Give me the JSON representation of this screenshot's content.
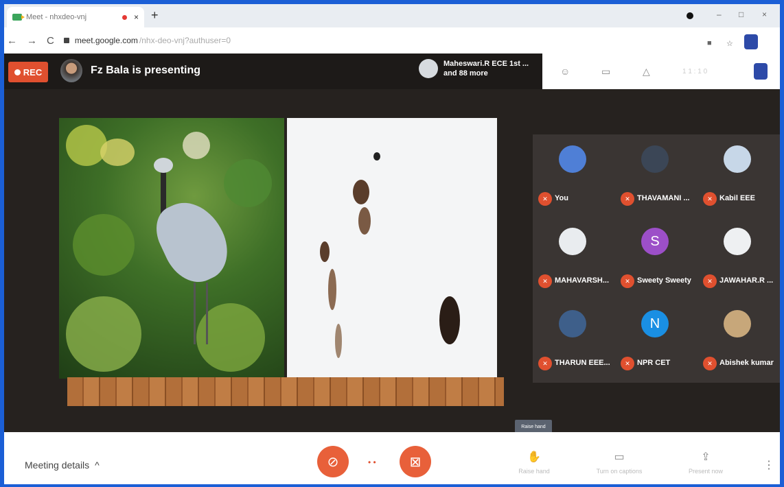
{
  "browser": {
    "tab_title": "Meet - nhxdeo-vnj",
    "tab_close": "×",
    "new_tab": "+",
    "win_controls": [
      "–",
      "□",
      "×"
    ],
    "nav": [
      "←",
      "→",
      "C"
    ],
    "url_host": "meet.google.com",
    "url_path": "/nhx-deo-vnj?authuser=0"
  },
  "meet": {
    "rec_label": "REC",
    "presenter_text": "Fz Bala is presenting",
    "people_line1": "Maheswari.R ECE 1st ...",
    "people_line2": "and 88 more",
    "top_icons": [
      "people-icon",
      "chat-icon",
      "activities-icon"
    ],
    "top_time": "1 1 : 1 0",
    "participants": [
      {
        "name": "You",
        "initial": "",
        "color": "#4f7fd6"
      },
      {
        "name": "THAVAMANI ...",
        "initial": "",
        "color": "#3b4656"
      },
      {
        "name": "Kabil EEE",
        "initial": "",
        "color": "#c7d7e8"
      },
      {
        "name": "MAHAVARSH...",
        "initial": "",
        "color": "#e9ecef"
      },
      {
        "name": "Sweety Sweety",
        "initial": "S",
        "color": "#9c4fc8"
      },
      {
        "name": "JAWAHAR.R ...",
        "initial": "",
        "color": "#eef0f2"
      },
      {
        "name": "THARUN EEE...",
        "initial": "",
        "color": "#3e5f8a"
      },
      {
        "name": "NPR CET",
        "initial": "N",
        "color": "#1a8fe3"
      },
      {
        "name": "Abishek kumar",
        "initial": "",
        "color": "#c7a77a"
      }
    ],
    "tooltip": "Raise hand"
  },
  "bottom": {
    "meeting_details": "Meeting details",
    "caret": "^",
    "raise_hand": "Raise hand",
    "captions": "Turn on captions",
    "present": "Present now"
  },
  "colors": {
    "accent_red": "#e0502f",
    "meet_bg": "#26221f"
  }
}
